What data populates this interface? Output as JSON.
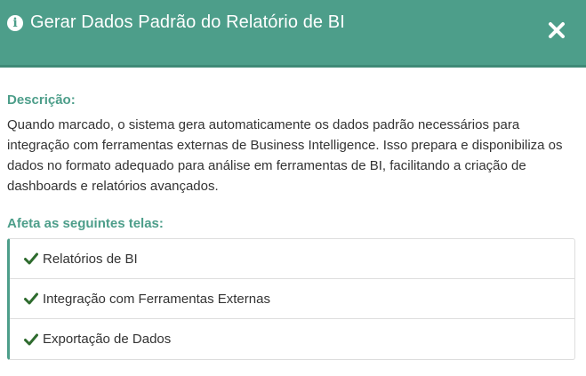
{
  "header": {
    "icon": "info-circle-icon",
    "title": "Gerar Dados Padrão do Relatório de BI",
    "close_icon": "close-icon",
    "background_color": "#4d9e8a"
  },
  "body": {
    "description_label": "Descrição:",
    "description_text": "Quando marcado, o sistema gera automaticamente os dados padrão necessários para integração com ferramentas externas de Business Intelligence. Isso prepara e disponibiliza os dados no formato adequado para análise em ferramentas de BI, facilitando a criação de dashboards e relatórios avançados.",
    "affects_label": "Afeta as seguintes telas:",
    "screens": [
      {
        "icon": "check-icon",
        "label": "Relatórios de BI"
      },
      {
        "icon": "check-icon",
        "label": "Integração com Ferramentas Externas"
      },
      {
        "icon": "check-icon",
        "label": "Exportação de Dados"
      }
    ],
    "check_color": "#2e6b2e",
    "accent_color": "#4d9e8a"
  }
}
